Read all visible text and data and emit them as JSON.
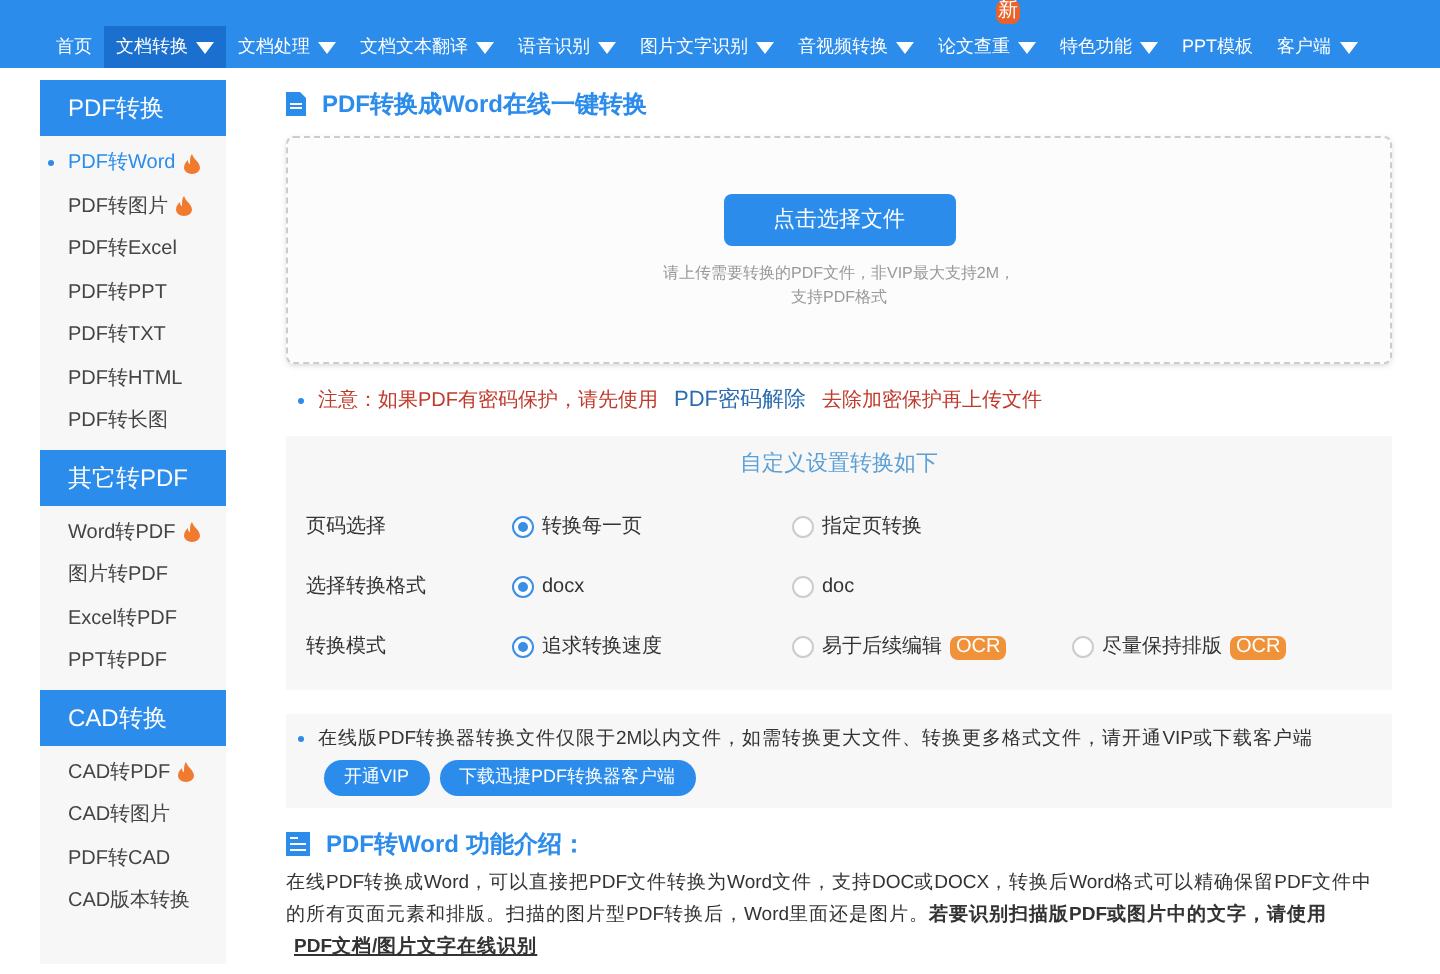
{
  "nav": [
    {
      "label": "首页",
      "selected": false,
      "dropdown": false
    },
    {
      "label": "文档转换",
      "selected": true,
      "dropdown": true
    },
    {
      "label": "文档处理",
      "selected": false,
      "dropdown": true
    },
    {
      "label": "文档文本翻译",
      "selected": false,
      "dropdown": true
    },
    {
      "label": "语音识别",
      "selected": false,
      "dropdown": true
    },
    {
      "label": "图片文字识别",
      "selected": false,
      "dropdown": true
    },
    {
      "label": "音视频转换",
      "selected": false,
      "dropdown": true
    },
    {
      "label": "论文查重",
      "selected": false,
      "dropdown": true,
      "badge": "新"
    },
    {
      "label": "特色功能",
      "selected": false,
      "dropdown": true
    },
    {
      "label": "PPT模板",
      "selected": false,
      "dropdown": false
    },
    {
      "label": "客户端",
      "selected": false,
      "dropdown": true
    }
  ],
  "sidebar": [
    {
      "title": "PDF转换",
      "items": [
        {
          "label": "PDF转Word",
          "selected": true,
          "hot": true
        },
        {
          "label": "PDF转图片",
          "selected": false,
          "hot": true
        },
        {
          "label": "PDF转Excel",
          "selected": false,
          "hot": false
        },
        {
          "label": "PDF转PPT",
          "selected": false,
          "hot": false
        },
        {
          "label": "PDF转TXT",
          "selected": false,
          "hot": false
        },
        {
          "label": "PDF转HTML",
          "selected": false,
          "hot": false
        },
        {
          "label": "PDF转长图",
          "selected": false,
          "hot": false
        }
      ]
    },
    {
      "title": "其它转PDF",
      "items": [
        {
          "label": "Word转PDF",
          "selected": false,
          "hot": true
        },
        {
          "label": "图片转PDF",
          "selected": false,
          "hot": false
        },
        {
          "label": "Excel转PDF",
          "selected": false,
          "hot": false
        },
        {
          "label": "PPT转PDF",
          "selected": false,
          "hot": false
        }
      ]
    },
    {
      "title": "CAD转换",
      "items": [
        {
          "label": "CAD转PDF",
          "selected": false,
          "hot": true
        },
        {
          "label": "CAD转图片",
          "selected": false,
          "hot": false
        },
        {
          "label": "PDF转CAD",
          "selected": false,
          "hot": false
        },
        {
          "label": "CAD版本转换",
          "selected": false,
          "hot": false
        }
      ]
    }
  ],
  "page_title": "PDF转换成Word在线一键转换",
  "upload": {
    "button": "点击选择文件",
    "hint_1": "请上传需要转换的PDF文件，非VIP最大支持2M，",
    "hint_2": "支持PDF格式"
  },
  "notice": {
    "before": "注意：如果PDF有密码保护，请先使用",
    "link": "PDF密码解除",
    "after": "去除加密保护再上传文件"
  },
  "settings": {
    "title": "自定义设置转换如下",
    "rows": [
      {
        "label": "页码选择",
        "options": [
          {
            "label": "转换每一页",
            "selected": true
          },
          {
            "label": "指定页转换",
            "selected": false
          }
        ]
      },
      {
        "label": "选择转换格式",
        "options": [
          {
            "label": "docx",
            "selected": true
          },
          {
            "label": "doc",
            "selected": false
          }
        ]
      },
      {
        "label": "转换模式",
        "options": [
          {
            "label": "追求转换速度",
            "selected": true
          },
          {
            "label": "易于后续编辑",
            "selected": false,
            "badge": "OCR"
          },
          {
            "label": "尽量保持排版",
            "selected": false,
            "badge": "OCR"
          }
        ]
      }
    ]
  },
  "vip_notice": {
    "text": "在线版PDF转换器转换文件仅限于2M以内文件，如需转换更大文件、转换更多格式文件，请开通VIP或下载客户端",
    "buttons": [
      "开通VIP",
      "下载迅捷PDF转换器客户端"
    ]
  },
  "intro": {
    "title": "PDF转Word 功能介绍：",
    "text": "在线PDF转换成Word，可以直接把PDF文件转换为Word文件，支持DOC或DOCX，转换后Word格式可以精确保留PDF文件中的所有页面元素和排版。扫描的图片型PDF转换后，Word里面还是图片。**若要识别扫描版PDF或图片中的文字，请使用**",
    "link": "PDF文档/图片文字在线识别"
  }
}
